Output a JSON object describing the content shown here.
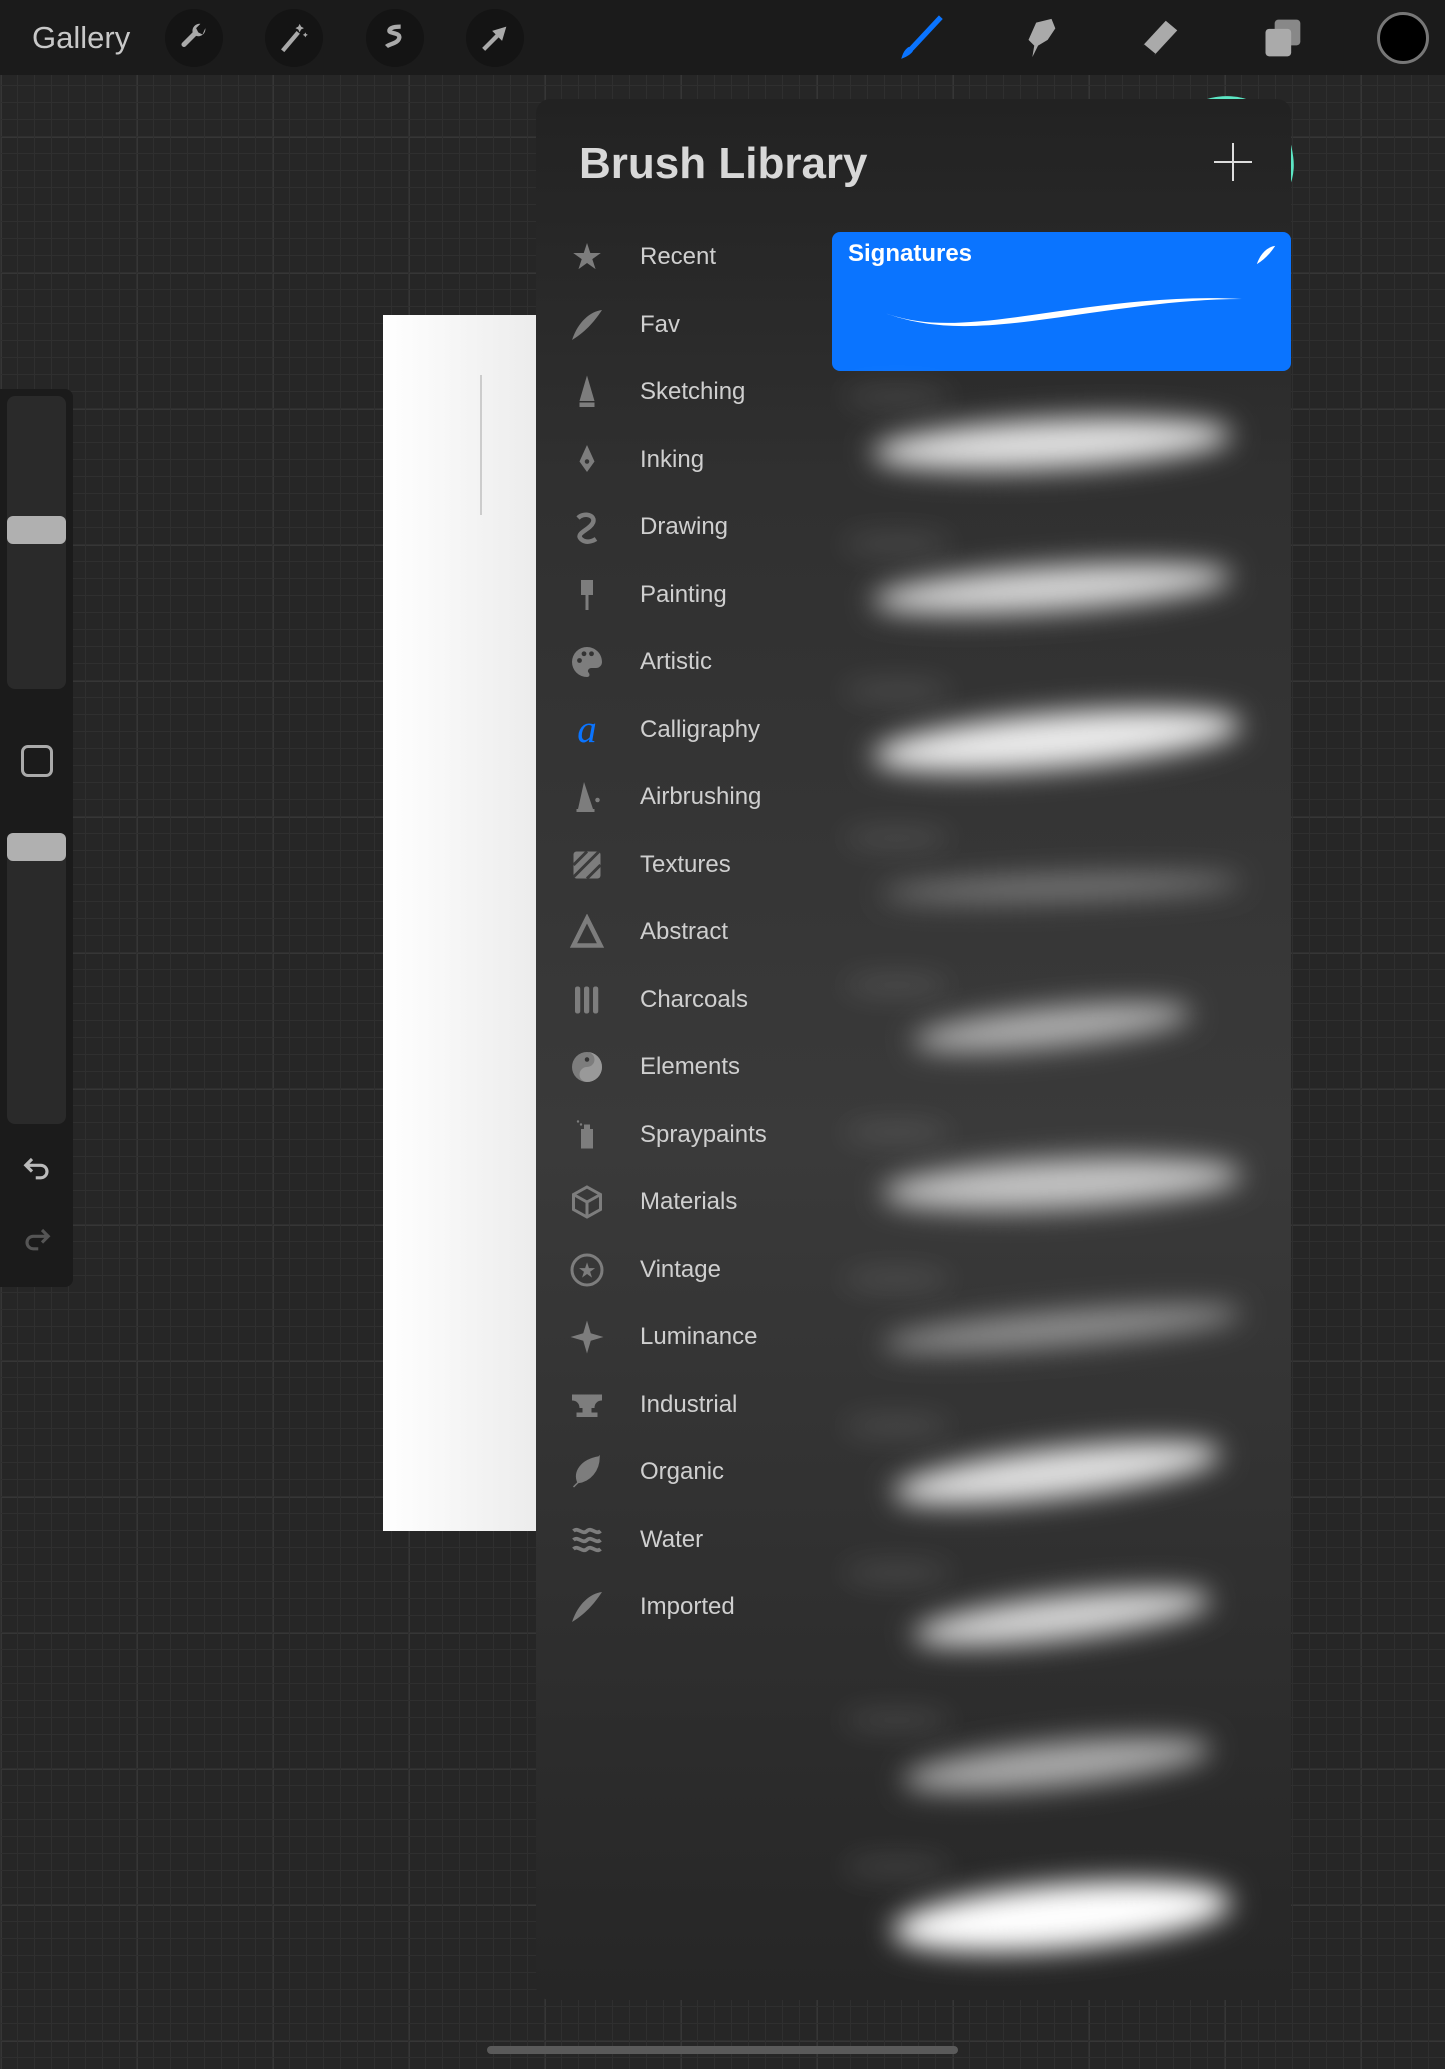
{
  "topbar": {
    "gallery": "Gallery",
    "tools": [
      "wrench-icon",
      "magic-wand-icon",
      "selection-icon",
      "transform-arrow-icon"
    ],
    "right_tools": [
      "brush-icon",
      "smudge-icon",
      "eraser-icon",
      "layers-icon"
    ],
    "active_tool": "brush",
    "accent": "#0a74ff",
    "current_color": "#000000"
  },
  "brush_library": {
    "title": "Brush Library",
    "add_button_icon": "plus-icon",
    "highlight_color": "#5ce6c4",
    "categories": [
      {
        "label": "Recent",
        "icon": "★"
      },
      {
        "label": "Fav",
        "icon": "feather"
      },
      {
        "label": "Sketching",
        "icon": "pencil"
      },
      {
        "label": "Inking",
        "icon": "pen-nib"
      },
      {
        "label": "Drawing",
        "icon": "squiggle"
      },
      {
        "label": "Painting",
        "icon": "paintbrush"
      },
      {
        "label": "Artistic",
        "icon": "palette"
      },
      {
        "label": "Calligraphy",
        "icon": "a"
      },
      {
        "label": "Airbrushing",
        "icon": "airbrush"
      },
      {
        "label": "Textures",
        "icon": "hatch"
      },
      {
        "label": "Abstract",
        "icon": "triangle"
      },
      {
        "label": "Charcoals",
        "icon": "sticks"
      },
      {
        "label": "Elements",
        "icon": "yin-yang"
      },
      {
        "label": "Spraypaints",
        "icon": "spray-can"
      },
      {
        "label": "Materials",
        "icon": "cube"
      },
      {
        "label": "Vintage",
        "icon": "star-circle"
      },
      {
        "label": "Luminance",
        "icon": "sparkle"
      },
      {
        "label": "Industrial",
        "icon": "anvil"
      },
      {
        "label": "Organic",
        "icon": "leaf"
      },
      {
        "label": "Water",
        "icon": "waves"
      },
      {
        "label": "Imported",
        "icon": "feather"
      }
    ],
    "selected_category": "Calligraphy",
    "selected_brush": "Signatures"
  }
}
